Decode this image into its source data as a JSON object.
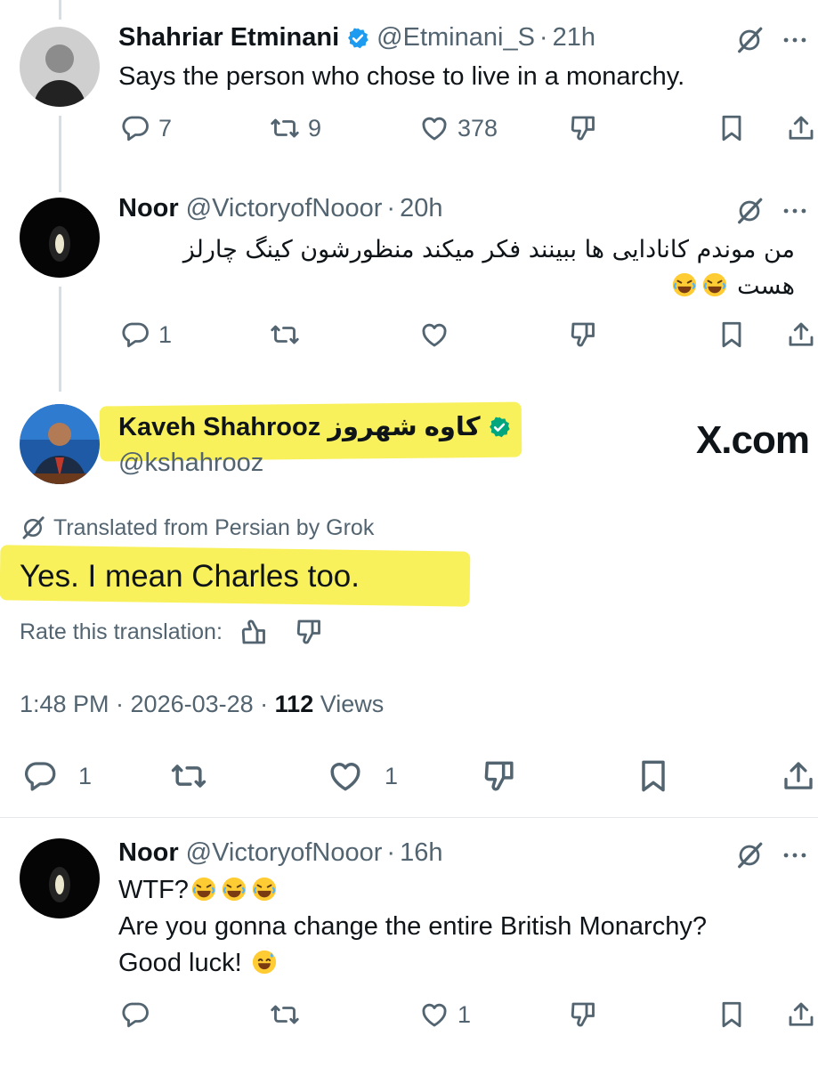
{
  "tweets": [
    {
      "name": "Shahriar Etminani",
      "handle": "@Etminani_S",
      "separator": "·",
      "time": "21h",
      "text": "Says the person who chose to live in a monarchy.",
      "replies": "7",
      "reposts": "9",
      "likes": "378"
    },
    {
      "name": "Noor",
      "handle": "@VictoryofNooor",
      "separator": "·",
      "time": "20h",
      "text_line1": "من موندم کانادایی ها ببینند فکر میکند منظورشون کینگ چارلز",
      "text_line2": "هست",
      "replies": "1"
    }
  ],
  "main_tweet": {
    "name": "Kaveh Shahrooz کاوه شهروز",
    "handle": "@kshahrooz",
    "translated_label": "Translated from Persian by Grok",
    "text": "Yes. I mean Charles too.",
    "rate_label": "Rate this translation:",
    "meta_time": "1:48 PM · 2026-03-28 · ",
    "views_count": "112",
    "views_label": " Views",
    "replies": "1",
    "likes": "1"
  },
  "watermark": "X.com",
  "last_reply": {
    "name": "Noor",
    "handle": "@VictoryofNooor",
    "separator": "·",
    "time": "16h",
    "line1": "WTF?",
    "line2": "Are you gonna change the entire British Monarchy?",
    "line3": "Good luck!",
    "likes": "1"
  },
  "colors": {
    "text": "#0f1419",
    "secondary": "#536471",
    "verified": "#1d9bf0",
    "verified_gold": "#00a67e",
    "highlight": "#f7ee3f"
  }
}
